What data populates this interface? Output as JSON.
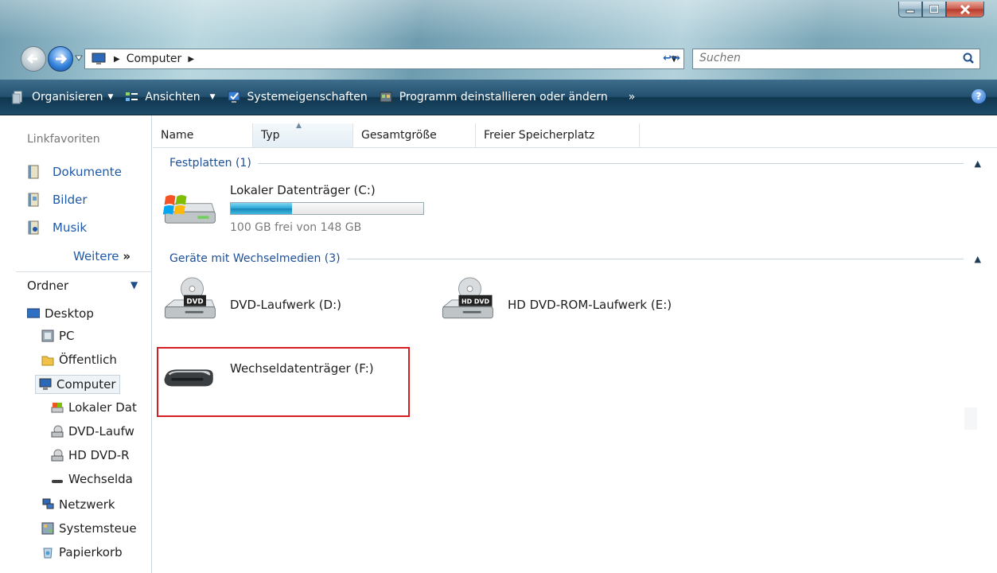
{
  "window": {
    "minimize_icon": "minimize-icon",
    "maximize_icon": "maximize-icon",
    "close_icon": "close-icon"
  },
  "address": {
    "crumb": "Computer",
    "search_placeholder": "Suchen"
  },
  "toolbar": {
    "organize": "Organisieren",
    "views": "Ansichten",
    "system_properties": "Systemeigenschaften",
    "uninstall": "Programm deinstallieren oder ändern",
    "more": "»",
    "help": "?"
  },
  "sidebar": {
    "favorites_header": "Linkfavoriten",
    "favorites": [
      {
        "label": "Dokumente",
        "icon": "documents-icon"
      },
      {
        "label": "Bilder",
        "icon": "pictures-icon"
      },
      {
        "label": "Musik",
        "icon": "music-icon"
      }
    ],
    "more_label": "Weitere",
    "more_glyph": "»",
    "folders_header": "Ordner",
    "tree": [
      {
        "label": "Desktop",
        "icon": "desktop-icon"
      },
      {
        "label": "PC",
        "icon": "user-folder-icon"
      },
      {
        "label": "Öffentlich",
        "icon": "public-folder-icon"
      },
      {
        "label": "Computer",
        "icon": "computer-icon"
      },
      {
        "label": "Lokaler Dat",
        "icon": "hard-drive-icon"
      },
      {
        "label": "DVD-Laufw",
        "icon": "dvd-drive-icon"
      },
      {
        "label": "HD DVD-R",
        "icon": "dvd-drive-icon"
      },
      {
        "label": "Wechselda",
        "icon": "removable-drive-icon"
      },
      {
        "label": "Netzwerk",
        "icon": "network-icon"
      },
      {
        "label": "Systemsteue",
        "icon": "control-panel-icon"
      },
      {
        "label": "Papierkorb",
        "icon": "recycle-bin-icon"
      }
    ]
  },
  "columns": [
    "Name",
    "Typ",
    "Gesamtgröße",
    "Freier Speicherplatz"
  ],
  "groups": {
    "hard_disks": "Festplatten (1)",
    "removable": "Geräte mit Wechselmedien (3)"
  },
  "drives": {
    "c": {
      "label": "Lokaler Datenträger (C:)",
      "free_text": "100 GB frei von 148 GB",
      "used_fraction": 0.32
    },
    "d": {
      "label": "DVD-Laufwerk (D:)",
      "badge": "DVD"
    },
    "e": {
      "label": "HD DVD-ROM-Laufwerk (E:)",
      "badge": "HD DVD"
    },
    "f": {
      "label": "Wechseldatenträger (F:)"
    }
  },
  "highlight_color": "#d51d24"
}
